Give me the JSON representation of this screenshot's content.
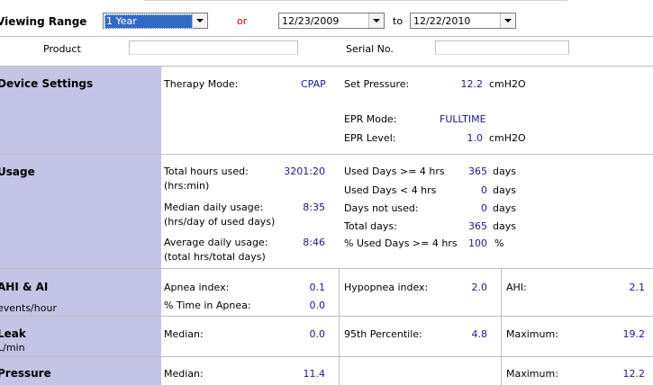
{
  "viewing_range": {
    "label": "Viewing Range",
    "selected": "1 Year",
    "or": "or",
    "from": "12/23/2009",
    "to_label": "to",
    "to": "12/22/2010"
  },
  "header": {
    "product_label": "Product",
    "serial_label": "Serial No.",
    "product_value": "",
    "serial_value": ""
  },
  "device_settings": {
    "title": "Device Settings",
    "therapy_mode_label": "Therapy Mode:",
    "therapy_mode": "CPAP",
    "set_pressure_label": "Set Pressure:",
    "set_pressure": "12.2",
    "set_pressure_unit": "cmH2O",
    "epr_mode_label": "EPR Mode:",
    "epr_mode": "FULLTIME",
    "epr_level_label": "EPR Level:",
    "epr_level": "1.0",
    "epr_level_unit": "cmH2O"
  },
  "usage": {
    "title": "Usage",
    "total_hours_label": "Total hours used:",
    "total_hours_sub": "(hrs:min)",
    "total_hours": "3201:20",
    "median_label": "Median daily usage:",
    "median_sub": "(hrs/day of used days)",
    "median": "8:35",
    "average_label": "Average daily usage:",
    "average_sub": "(total hrs/total days)",
    "average": "8:46",
    "used_ge4_label": "Used Days >= 4 hrs",
    "used_ge4": "365",
    "days_unit": "days",
    "used_lt4_label": "Used Days < 4 hrs",
    "used_lt4": "0",
    "not_used_label": "Days not used:",
    "not_used": "0",
    "total_days_label": "Total days:",
    "total_days": "365",
    "pct_label": "% Used Days >= 4 hrs",
    "pct": "100",
    "pct_unit": "%"
  },
  "ahi": {
    "title": "AHI & AI",
    "subtitle": "events/hour",
    "apnea_label": "Apnea index:",
    "apnea": "0.1",
    "pct_apnea_label": "% Time in Apnea:",
    "pct_apnea": "0.0",
    "hypopnea_label": "Hypopnea index:",
    "hypopnea": "2.0",
    "ahi_label": "AHI:",
    "ahi": "2.1"
  },
  "leak": {
    "title": "Leak",
    "subtitle": "L/min",
    "median_label": "Median:",
    "median": "0.0",
    "p95_label": "95th Percentile:",
    "p95": "4.8",
    "max_label": "Maximum:",
    "max": "19.2"
  },
  "pressure": {
    "title": "Pressure",
    "median_label": "Median:",
    "median": "11.4",
    "max_label": "Maximum:",
    "max": "12.2"
  }
}
